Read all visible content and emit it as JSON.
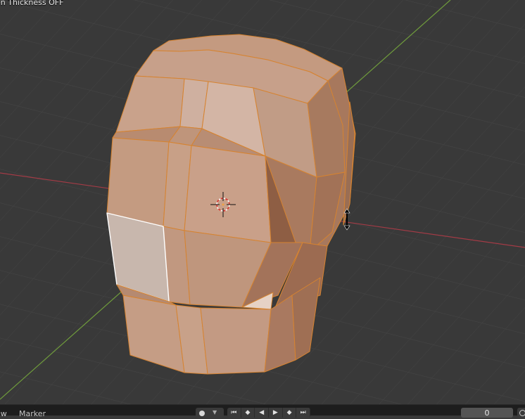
{
  "viewport": {
    "status_text": "en Thickness OFF"
  },
  "timeline": {
    "menu_view": "ew",
    "menu_marker": "Marker",
    "current_frame": "0",
    "transport_icons": [
      "jump-start",
      "prev-keyframe",
      "play-reverse",
      "play",
      "next-keyframe",
      "jump-end"
    ]
  },
  "colors": {
    "background": "#393939",
    "grid": "#444444",
    "x_axis": "#a33b46",
    "y_axis": "#6f9b3c",
    "mesh_face": "#c69c80",
    "mesh_edge": "#e2882c",
    "selected_face": "#ffffff"
  }
}
